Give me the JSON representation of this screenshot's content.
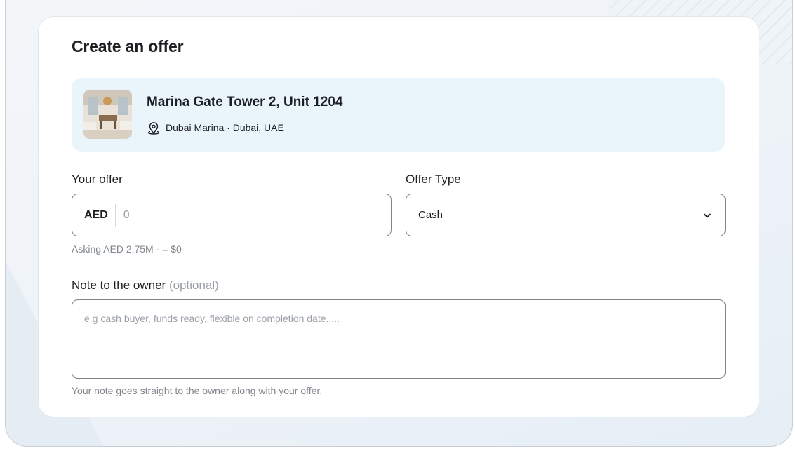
{
  "page": {
    "title": "Create an offer"
  },
  "property": {
    "name": "Marina Gate Tower 2, Unit 1204",
    "location": "Dubai Marina · Dubai, UAE",
    "pin_icon": "location-pin-icon"
  },
  "offer": {
    "label": "Your offer",
    "currency": "AED",
    "value": "",
    "placeholder": "0",
    "asking_hint": "Asking AED 2.75M · = $0"
  },
  "offer_type": {
    "label": "Offer Type",
    "selected": "Cash",
    "chevron_icon": "chevron-down-icon"
  },
  "note": {
    "label": "Note to the owner",
    "optional": "(optional)",
    "value": "",
    "placeholder": "e.g cash buyer, funds ready, flexible on completion date.....",
    "hint": "Your note goes straight to the owner along with your offer."
  },
  "colors": {
    "property_bg": "#e9f5fb",
    "border": "#7f848c",
    "muted_text": "#80868e",
    "text": "#1d1f23"
  }
}
